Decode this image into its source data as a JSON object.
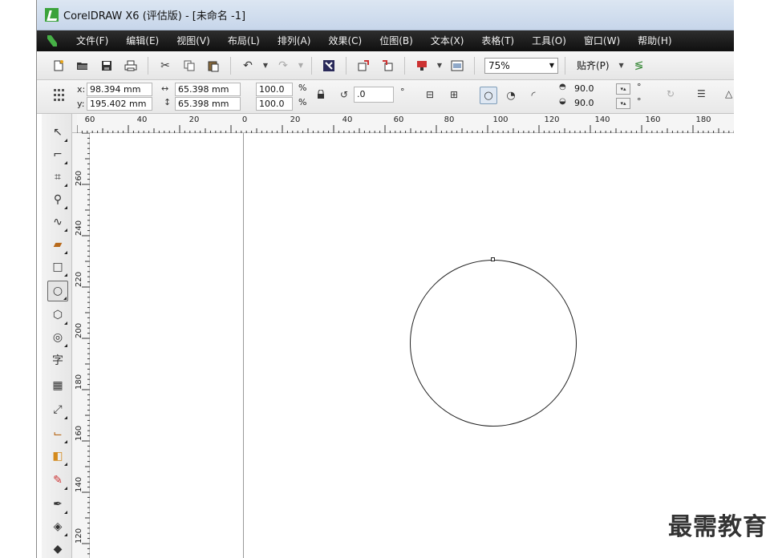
{
  "window": {
    "title": "CorelDRAW X6 (评估版) - [未命名 -1]"
  },
  "menu": {
    "items": [
      "文件(F)",
      "编辑(E)",
      "视图(V)",
      "布局(L)",
      "排列(A)",
      "效果(C)",
      "位图(B)",
      "文本(X)",
      "表格(T)",
      "工具(O)",
      "窗口(W)",
      "帮助(H)"
    ]
  },
  "toolbar": {
    "zoom_value": "75%",
    "snap_label": "贴齐(P)"
  },
  "property_bar": {
    "x_label": "x:",
    "y_label": "y:",
    "x_value": "98.394 mm",
    "y_value": "195.402 mm",
    "width_value": "65.398 mm",
    "height_value": "65.398 mm",
    "scale_x": "100.0",
    "scale_y": "100.0",
    "percent": "%",
    "rotation_value": ".0",
    "degree": "°",
    "start_angle": "90.0",
    "end_angle": "90.0"
  },
  "rulers": {
    "horizontal_ticks": [
      "60",
      "40",
      "20",
      "0",
      "20",
      "40",
      "60",
      "80",
      "100",
      "120",
      "140",
      "160",
      "180"
    ],
    "vertical_ticks": [
      "260",
      "240",
      "220",
      "200",
      "180",
      "160",
      "140",
      "120"
    ],
    "corner_icon": "ruler-origin-icon"
  },
  "toolbox": {
    "tools": [
      "pick-tool-icon",
      "shape-tool-icon",
      "crop-tool-icon",
      "zoom-tool-icon",
      "freehand-tool-icon",
      "smart-fill-tool-icon",
      "rectangle-tool-icon",
      "ellipse-tool-icon",
      "polygon-tool-icon",
      "basic-shapes-tool-icon",
      "text-tool-icon",
      "table-tool-icon",
      "dimension-tool-icon",
      "connector-tool-icon",
      "interactive-effects-tool-icon",
      "eyedropper-tool-icon",
      "outline-pen-tool-icon",
      "fill-tool-icon",
      "interactive-fill-tool-icon"
    ],
    "text_tool_glyph": "字"
  },
  "watermark": {
    "text": "最需教育"
  }
}
